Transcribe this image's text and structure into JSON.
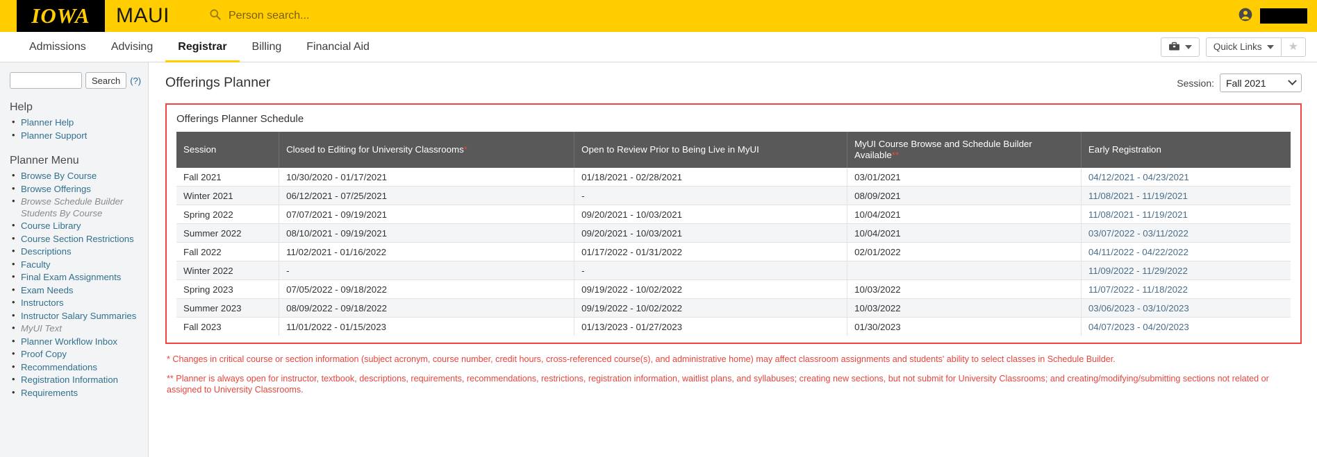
{
  "topbar": {
    "logo_text": "IOWA",
    "app_name": "MAUI",
    "search_icon": "search-icon",
    "search_placeholder": "Person search...",
    "account_icon": "account-circle-icon"
  },
  "nav": {
    "items": [
      {
        "label": "Admissions",
        "active": false
      },
      {
        "label": "Advising",
        "active": false
      },
      {
        "label": "Registrar",
        "active": true
      },
      {
        "label": "Billing",
        "active": false
      },
      {
        "label": "Financial Aid",
        "active": false
      }
    ],
    "toolbox_icon": "toolbox-icon",
    "quick_links_label": "Quick Links",
    "favorite_icon": "star-icon"
  },
  "sidebar": {
    "search_value": "",
    "search_button": "Search",
    "help_hint": "(?)",
    "help_heading": "Help",
    "help_items": [
      {
        "label": "Planner Help",
        "disabled": false
      },
      {
        "label": "Planner Support",
        "disabled": false
      }
    ],
    "menu_heading": "Planner Menu",
    "menu_items": [
      {
        "label": "Browse By Course",
        "disabled": false
      },
      {
        "label": "Browse Offerings",
        "disabled": false
      },
      {
        "label": "Browse Schedule Builder Students By Course",
        "disabled": true
      },
      {
        "label": "Course Library",
        "disabled": false
      },
      {
        "label": "Course Section Restrictions",
        "disabled": false
      },
      {
        "label": "Descriptions",
        "disabled": false
      },
      {
        "label": "Faculty",
        "disabled": false
      },
      {
        "label": "Final Exam Assignments",
        "disabled": false
      },
      {
        "label": "Exam Needs",
        "disabled": false
      },
      {
        "label": "Instructors",
        "disabled": false
      },
      {
        "label": "Instructor Salary Summaries",
        "disabled": false
      },
      {
        "label": "MyUI Text",
        "disabled": true
      },
      {
        "label": "Planner Workflow Inbox",
        "disabled": false
      },
      {
        "label": "Proof Copy",
        "disabled": false
      },
      {
        "label": "Recommendations",
        "disabled": false
      },
      {
        "label": "Registration Information",
        "disabled": false
      },
      {
        "label": "Requirements",
        "disabled": false
      }
    ]
  },
  "main": {
    "page_title": "Offerings Planner",
    "session_label": "Session:",
    "session_value": "Fall 2021",
    "panel_title": "Offerings Planner Schedule",
    "table": {
      "columns": [
        {
          "label": "Session",
          "asterisk": ""
        },
        {
          "label": "Closed to Editing for University Classrooms",
          "asterisk": "*"
        },
        {
          "label": "Open to Review Prior to Being Live in MyUI",
          "asterisk": ""
        },
        {
          "label": "MyUI Course Browse and Schedule Builder Available",
          "asterisk": "**"
        },
        {
          "label": "Early Registration",
          "asterisk": ""
        }
      ],
      "rows": [
        {
          "session": "Fall 2021",
          "closed": "10/30/2020  -  01/17/2021",
          "review": "01/18/2021  -  02/28/2021",
          "myui": "03/01/2021",
          "early": "04/12/2021  -  04/23/2021"
        },
        {
          "session": "Winter 2021",
          "closed": "06/12/2021  -  07/25/2021",
          "review": "-",
          "myui": "08/09/2021",
          "early": "11/08/2021  -  11/19/2021"
        },
        {
          "session": "Spring 2022",
          "closed": "07/07/2021  -  09/19/2021",
          "review": "09/20/2021  -  10/03/2021",
          "myui": "10/04/2021",
          "early": "11/08/2021  -  11/19/2021"
        },
        {
          "session": "Summer 2022",
          "closed": "08/10/2021  -  09/19/2021",
          "review": "09/20/2021  -  10/03/2021",
          "myui": "10/04/2021",
          "early": "03/07/2022  -  03/11/2022"
        },
        {
          "session": "Fall 2022",
          "closed": "11/02/2021  -  01/16/2022",
          "review": "01/17/2022  -  01/31/2022",
          "myui": "02/01/2022",
          "early": "04/11/2022  -  04/22/2022"
        },
        {
          "session": "Winter 2022",
          "closed": "-",
          "review": "-",
          "myui": "",
          "early": "11/09/2022  -  11/29/2022"
        },
        {
          "session": "Spring 2023",
          "closed": "07/05/2022  -  09/18/2022",
          "review": "09/19/2022  -  10/02/2022",
          "myui": "10/03/2022",
          "early": "11/07/2022  -  11/18/2022"
        },
        {
          "session": "Summer 2023",
          "closed": "08/09/2022  -  09/18/2022",
          "review": "09/19/2022  -  10/02/2022",
          "myui": "10/03/2022",
          "early": "03/06/2023  -  03/10/2023"
        },
        {
          "session": "Fall 2023",
          "closed": "11/01/2022  -  01/15/2023",
          "review": "01/13/2023  -  01/27/2023",
          "myui": "01/30/2023",
          "early": "04/07/2023  -  04/20/2023"
        }
      ]
    },
    "footnote_1": "* Changes in critical course or section information (subject acronym, course number, credit hours, cross-referenced course(s), and administrative home) may affect classroom assignments and students' ability to select classes in Schedule Builder.",
    "footnote_2": "** Planner is always open for instructor, textbook, descriptions, requirements, recommendations, restrictions, registration information, waitlist plans, and syllabuses; creating new sections, but not submit for University Classrooms; and creating/modifying/submitting sections not related or assigned to University Classrooms."
  },
  "colors": {
    "brand_gold": "#ffcd00",
    "panel_border_red": "#f0453c",
    "table_header_gray": "#595959",
    "link_blue": "#31708f"
  }
}
